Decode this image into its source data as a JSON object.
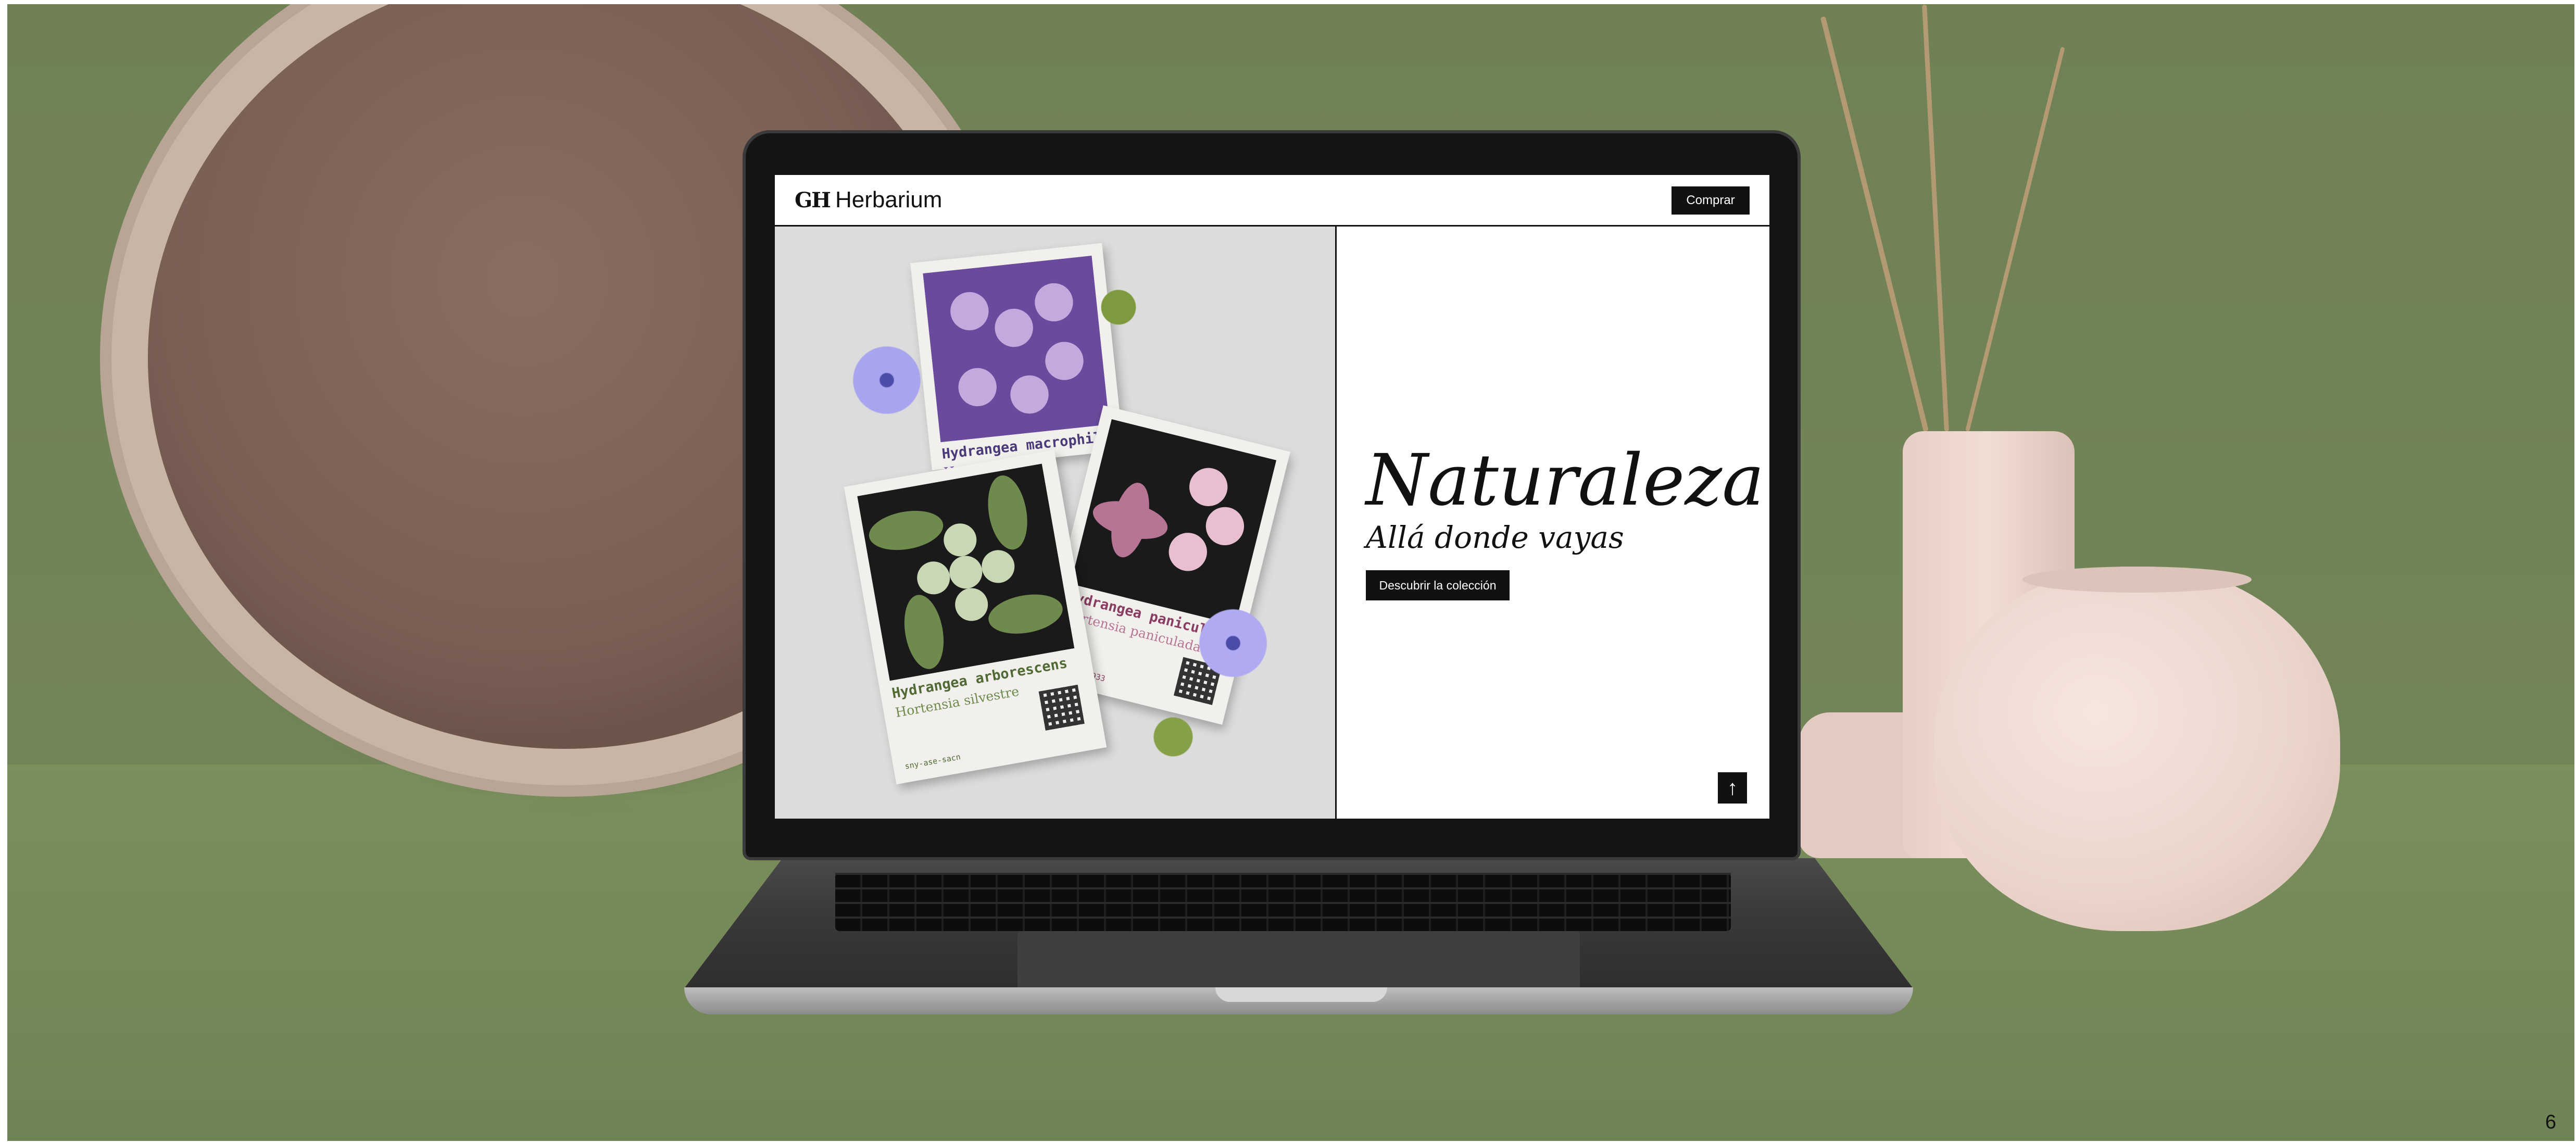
{
  "navbar": {
    "logo_mark": "GH",
    "logo_text": "Herbarium",
    "buy_label": "Comprar"
  },
  "hero": {
    "title": "Naturaleza",
    "subtitle": "Allá donde vayas",
    "cta_label": "Descubrir la colección",
    "back_to_top_icon": "↑"
  },
  "posters": [
    {
      "name": "Hydrangea macrophilla",
      "sub": "Hortensia",
      "color": "#6a4a9c",
      "light": "#c4a9de"
    },
    {
      "name": "Hydrangea paniculata",
      "sub": "Hortensia paniculada",
      "code": "mty-bom-2933",
      "color": "#b77596",
      "light": "#e7bfd0"
    },
    {
      "name": "Hydrangea arborescens",
      "sub": "Hortensia silvestre",
      "code": "sny-ase-sacn",
      "color": "#6f8a4d",
      "light": "#c9d7b4"
    }
  ],
  "page_number": "6",
  "colors": {
    "accent": "#111111",
    "background": "#ffffff",
    "hero_image_bg": "#dcdcdc"
  }
}
